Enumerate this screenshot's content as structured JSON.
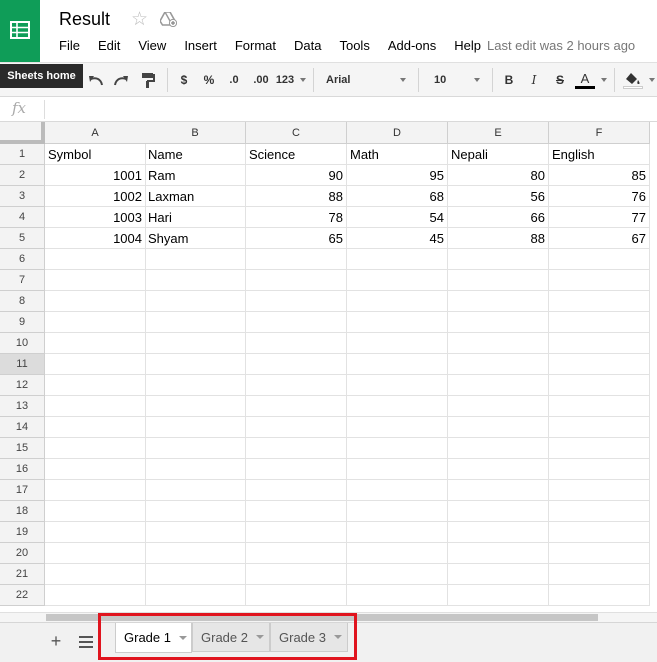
{
  "app": {
    "title": "Result",
    "star_icon": "star-outline-icon",
    "drive_icon": "add-to-drive-icon",
    "logo_icon": "sheets-grid-icon",
    "brand_color": "#0f9d58",
    "last_edit": "Last edit was 2 hours ago",
    "tooltip": "Sheets home"
  },
  "menu": [
    "File",
    "Edit",
    "View",
    "Insert",
    "Format",
    "Data",
    "Tools",
    "Add-ons",
    "Help"
  ],
  "toolbar": {
    "currency": "$",
    "percent": "%",
    "dec_decrease": ".0",
    "dec_increase": ".00",
    "more_formats": "123",
    "font": "Arial",
    "font_size": "10",
    "bold": "B",
    "italic": "I",
    "strike": "S",
    "text_color": "A",
    "text_color_value": "#000000"
  },
  "formula_bar": {
    "fx_label": "fx",
    "value": ""
  },
  "columns": [
    "A",
    "B",
    "C",
    "D",
    "E",
    "F"
  ],
  "rows": [
    "1",
    "2",
    "3",
    "4",
    "5",
    "6",
    "7",
    "8",
    "9",
    "10",
    "11",
    "12",
    "13",
    "14",
    "15",
    "16",
    "17",
    "18",
    "19",
    "20",
    "21",
    "22"
  ],
  "selected_row": "11",
  "cells": [
    [
      "Symbol",
      "Name",
      "Science",
      "Math",
      "Nepali",
      "English"
    ],
    [
      "1001",
      "Ram",
      "90",
      "95",
      "80",
      "85"
    ],
    [
      "1002",
      "Laxman",
      "88",
      "68",
      "56",
      "76"
    ],
    [
      "1003",
      "Hari",
      "78",
      "54",
      "66",
      "77"
    ],
    [
      "1004",
      "Shyam",
      "65",
      "45",
      "88",
      "67"
    ]
  ],
  "sheets": [
    {
      "label": "Grade 1",
      "active": true
    },
    {
      "label": "Grade 2",
      "active": false
    },
    {
      "label": "Grade 3",
      "active": false
    }
  ],
  "annotation_color": "#e0141e"
}
